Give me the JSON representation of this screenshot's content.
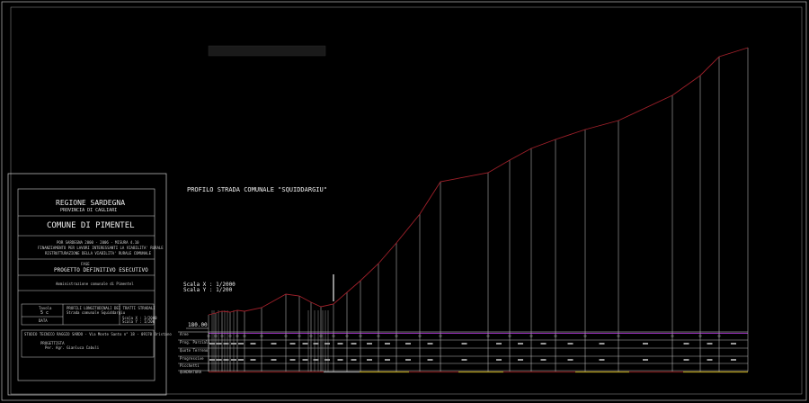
{
  "title_block": {
    "region": "REGIONE SARDEGNA",
    "province": "PROVINCIA DI CAGLIARI",
    "comune": "COMUNE DI PIMENTEL",
    "program_lines": [
      "POR SARDEGNA 2000 - 2006 - MISURA 4.10",
      "FINANZIAMENTO PER LAVORI INTERESSANTI LA VIABILITA' RURALE",
      "RISTRUTTURAZIONE DELLA VIABILITA' RURALE COMUNALE"
    ],
    "phase_label": "FASE",
    "phase": "PROGETTO DEFINITIVO ESECUTIVO",
    "client": "Amministrazione comunale di Pimentel",
    "table_label": "Tavola",
    "table_number": "5 c",
    "table_title": "PROFILI LONGITUDINALI DEI TRATTI STRADALI",
    "table_subtitle": "Strada comunale Squiddargiu",
    "date_label": "DATA",
    "scale_x": "Scala X : 1/2000",
    "scale_y": "Scala Y : 1/200",
    "studio": "STUDIO TECNICO RAGGIO SARDO - Via Monte Santo n° 18 - 09170 Oristano",
    "designer_label": "PROGETTISTA",
    "designer": "Per. Agr. Gianluca Cabuli"
  },
  "drawing": {
    "profile_title": "PROFILO STRADA COMUNALE \"SQUIDDARGIU\"",
    "scale_x": "Scala X : 1/2000",
    "scale_y": "Scala Y : 1/200",
    "datum": "180.00",
    "table_row_labels": [
      "Aree",
      "Prog. Parziali",
      "Quote Terreno",
      "Progressive",
      "Picchetti"
    ],
    "footer_label": "QUADRATURA",
    "profile_color": "#a0202a",
    "aree_line_color": "#9a2fbf"
  }
}
